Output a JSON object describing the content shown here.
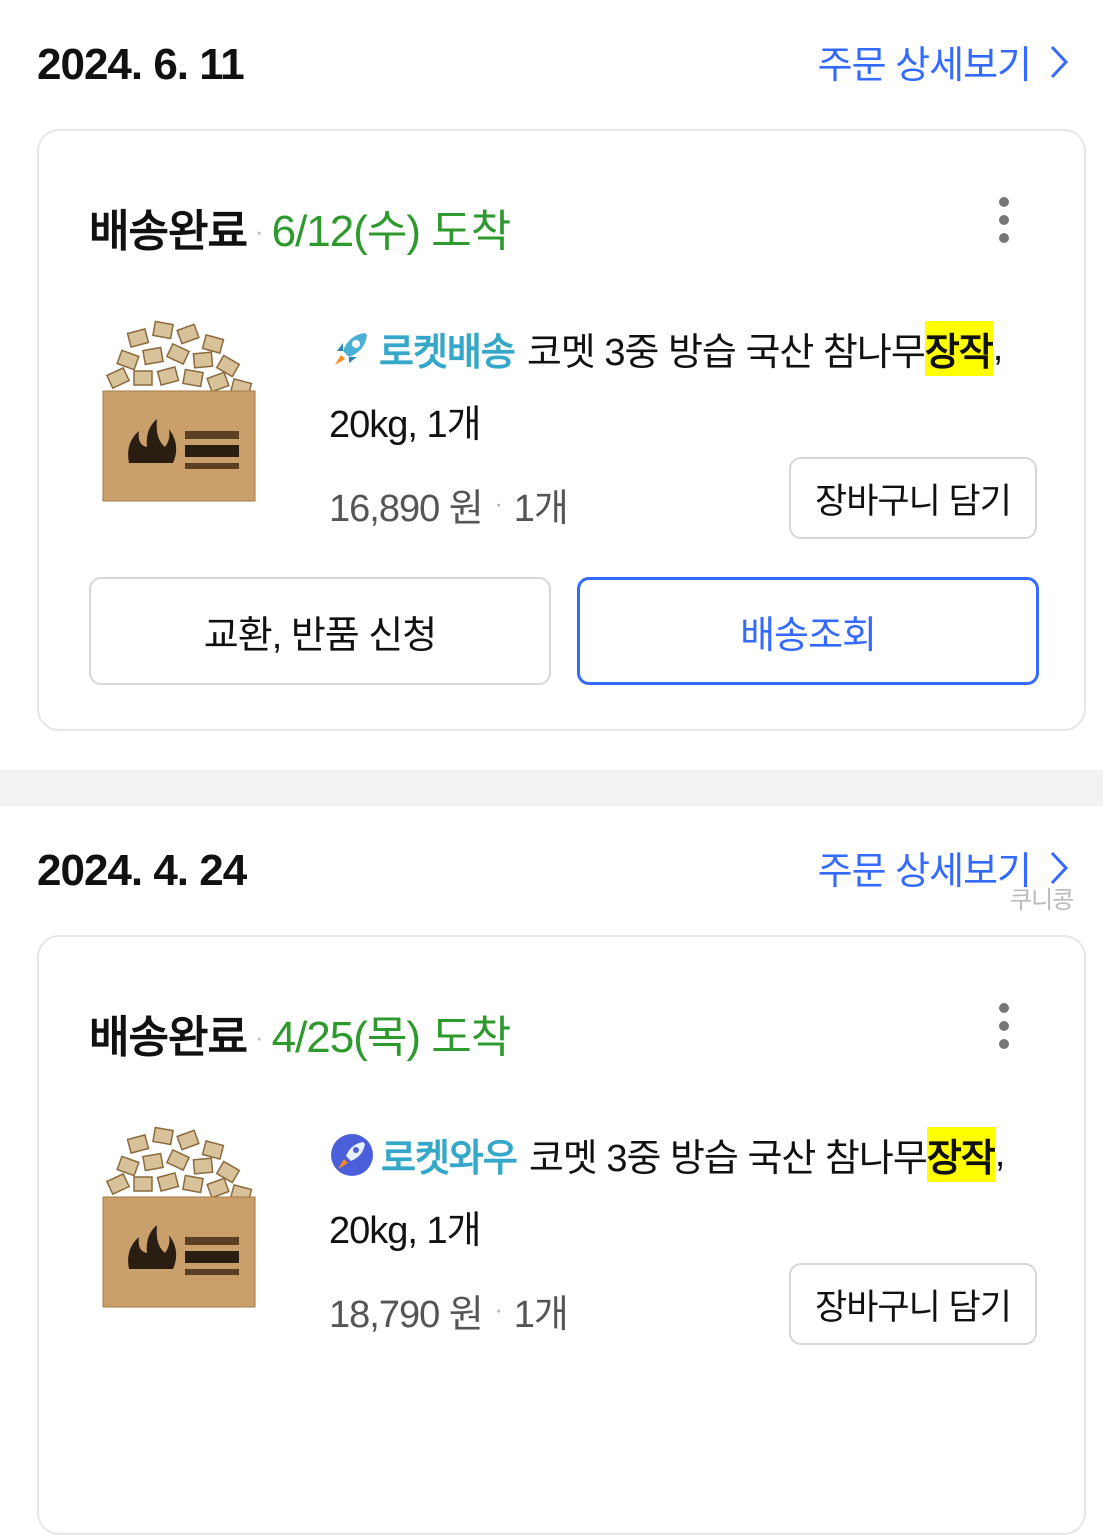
{
  "orders": [
    {
      "date": "2024. 6. 11",
      "detail_link": "주문 상세보기",
      "status": "배송완료",
      "arrival": "6/12(수) 도착",
      "badge": "로켓배송",
      "badge_icon": "rocket-icon",
      "title_main": "코멧 3중 방습 국산 참나무 ",
      "title_highlight": "장작",
      "title_comma": ",",
      "title_line2": "20kg, 1개",
      "price": "16,890 원",
      "qty": "1개",
      "cart_button": "장바구니 담기",
      "return_button": "교환, 반품 신청",
      "track_button": "배송조회"
    },
    {
      "date": "2024. 4. 24",
      "detail_link": "주문 상세보기",
      "status": "배송완료",
      "arrival": "4/25(목) 도착",
      "badge": "로켓와우",
      "badge_icon": "rocket-wow-icon",
      "title_main": "코멧 3중 방습 국산 참나무 ",
      "title_highlight": "장작",
      "title_comma": ",",
      "title_line2": "20kg, 1개",
      "price": "18,790 원",
      "qty": "1개",
      "cart_button": "장바구니 담기"
    }
  ],
  "separator_dot": "·",
  "watermark": "쿠니콩",
  "colors": {
    "accent_blue": "#346aff",
    "arrival_green": "#2e9a2e",
    "rocket_teal": "#35a7c8",
    "highlight_yellow": "#ffff00"
  }
}
